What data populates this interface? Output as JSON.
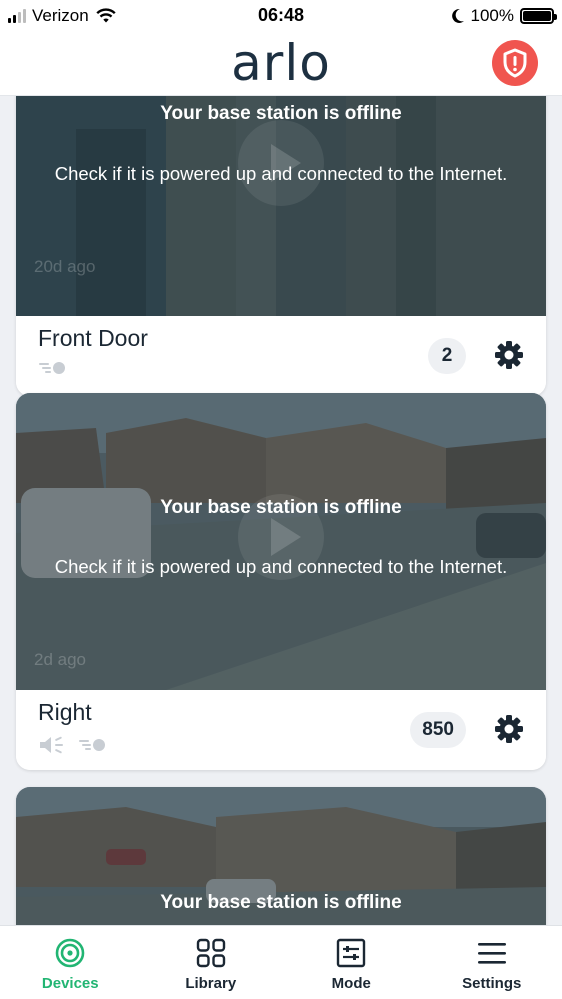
{
  "status_bar": {
    "carrier": "Verizon",
    "time": "06:48",
    "battery": "100%"
  },
  "header": {
    "logo": "arlo",
    "alert_icon": "shield-alert-icon"
  },
  "devices": [
    {
      "name": "Front Door",
      "offline_title": "Your base station is offline",
      "offline_body": "Check if it is powered up and connected to the Internet.",
      "last_activity": "20d ago",
      "count": "2",
      "status_icons": [
        "motion-icon"
      ]
    },
    {
      "name": "Right",
      "offline_title": "Your base station is offline",
      "offline_body": "Check if it is powered up and connected to the Internet.",
      "last_activity": "2d ago",
      "count": "850",
      "status_icons": [
        "speaker-muted-icon",
        "motion-icon"
      ]
    },
    {
      "offline_title": "Your base station is offline"
    }
  ],
  "bottom_nav": [
    {
      "label": "Devices",
      "icon": "devices-icon",
      "active": true
    },
    {
      "label": "Library",
      "icon": "library-grid-icon",
      "active": false
    },
    {
      "label": "Mode",
      "icon": "mode-sliders-icon",
      "active": false
    },
    {
      "label": "Settings",
      "icon": "hamburger-menu-icon",
      "active": false
    }
  ],
  "colors": {
    "accent": "#22b573",
    "alert": "#f0554f",
    "text": "#1b2733"
  }
}
